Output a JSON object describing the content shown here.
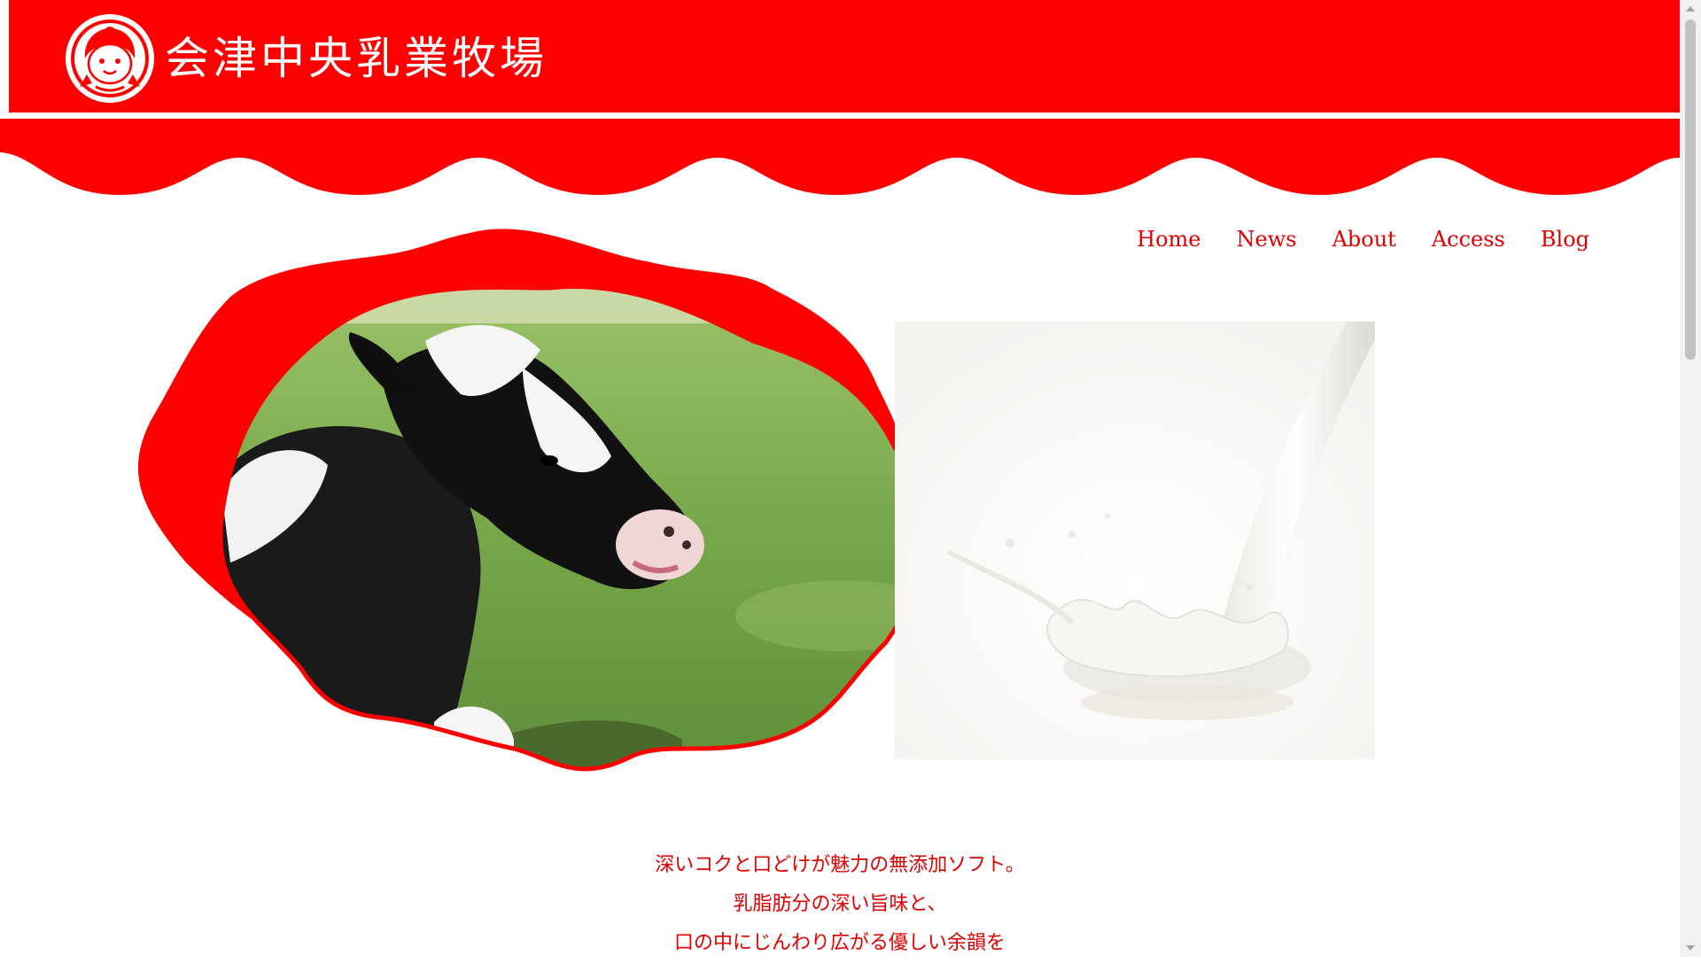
{
  "site": {
    "title": "会津中央乳業牧場",
    "brand_red": "#ff0000",
    "logo_icon": "girl-mascot-icon"
  },
  "nav": {
    "items": [
      {
        "label": "Home"
      },
      {
        "label": "News"
      },
      {
        "label": "About"
      },
      {
        "label": "Access"
      },
      {
        "label": "Blog"
      }
    ]
  },
  "hero": {
    "left_image": "cow-in-pasture-photo",
    "right_image": "milk-pour-splash-photo"
  },
  "tagline": {
    "lines": [
      "深いコクと口どけが魅力の無添加ソフト。",
      "乳脂肪分の深い旨味と、",
      "口の中にじんわり広がる優しい余韻を"
    ]
  }
}
